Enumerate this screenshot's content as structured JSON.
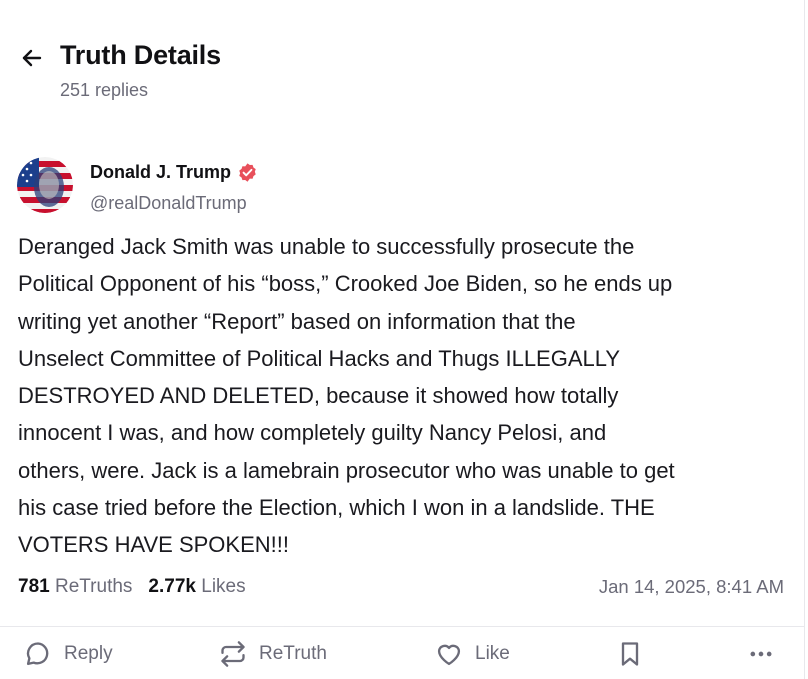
{
  "header": {
    "title": "Truth Details",
    "subtitle": "251 replies"
  },
  "post": {
    "author_name": "Donald J. Trump",
    "handle": "@realDonaldTrump",
    "lines": [
      "Deranged Jack Smith was unable to successfully prosecute the",
      "Political Opponent of his “boss,” Crooked Joe Biden, so he ends up",
      "writing yet another “Report” based on information that the",
      "Unselect Committee of Political Hacks  and Thugs ILLEGALLY",
      "DESTROYED AND DELETED, because it showed how totally",
      "innocent I was, and how completely guilty Nancy Pelosi, and",
      "others, were. Jack is a lamebrain prosecutor who was unable to get",
      "his case tried before the Election, which I won in a landslide. THE",
      "VOTERS HAVE SPOKEN!!!"
    ],
    "retruths_count": "781",
    "retruths_label": "ReTruths",
    "likes_count": "2.77k",
    "likes_label": "Likes",
    "date": "Jan 14, 2025, 8:41 AM"
  },
  "actions": {
    "reply_label": "Reply",
    "retruth_label": "ReTruth",
    "like_label": "Like"
  },
  "colors": {
    "verified": "#e8505b",
    "muted": "#6b6b78",
    "text": "#111114"
  },
  "icons": [
    "back-arrow-icon",
    "verified-badge-icon",
    "reply-icon",
    "retruth-icon",
    "like-heart-icon",
    "bookmark-icon",
    "more-icon"
  ]
}
